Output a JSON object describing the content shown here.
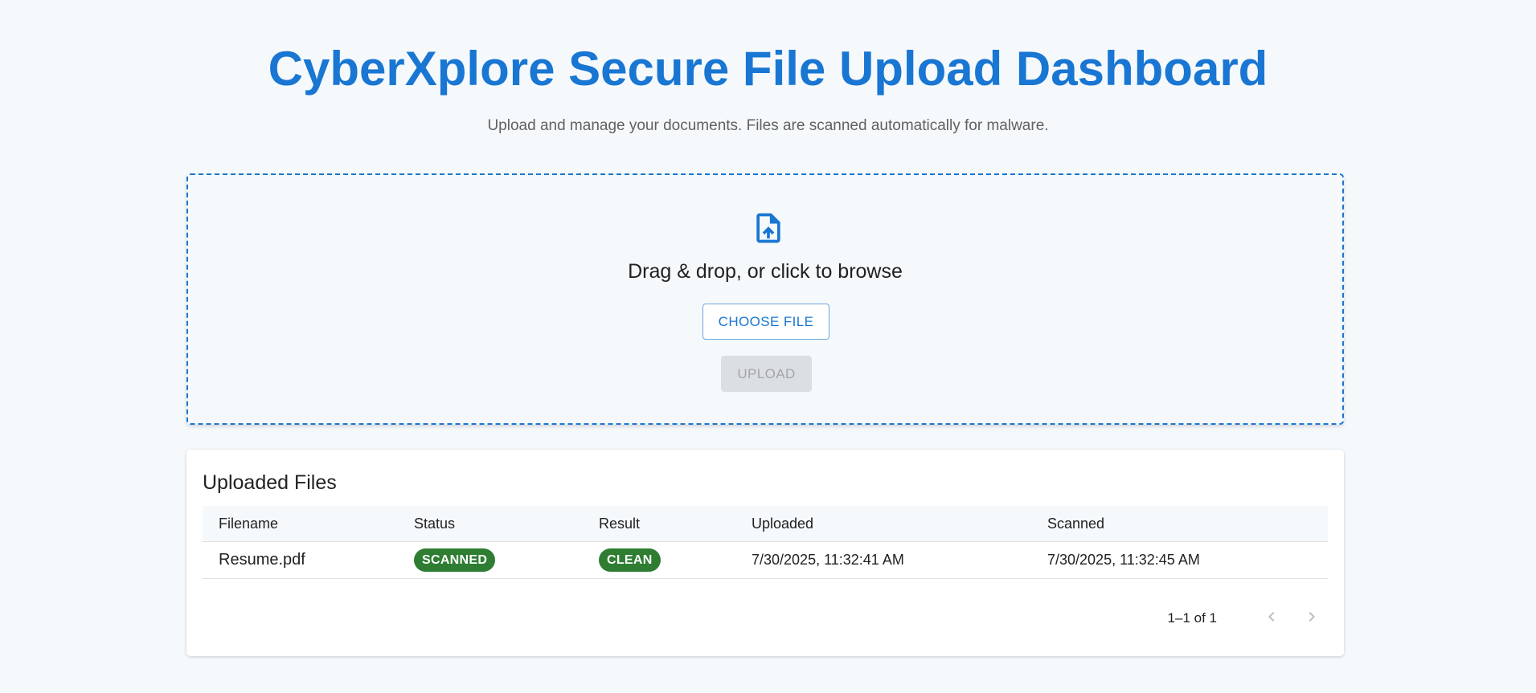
{
  "header": {
    "title": "CyberXplore Secure File Upload Dashboard",
    "subtitle": "Upload and manage your documents. Files are scanned automatically for malware."
  },
  "dropzone": {
    "icon": "file-upload-icon",
    "prompt": "Drag & drop, or click to browse",
    "choose_label": "CHOOSE FILE",
    "upload_label": "UPLOAD",
    "upload_disabled": true
  },
  "files": {
    "title": "Uploaded Files",
    "columns": [
      "Filename",
      "Status",
      "Result",
      "Uploaded",
      "Scanned"
    ],
    "rows": [
      {
        "filename": "Resume.pdf",
        "status": "SCANNED",
        "result": "CLEAN",
        "uploaded": "7/30/2025, 11:32:41 AM",
        "scanned": "7/30/2025, 11:32:45 AM"
      }
    ],
    "pagination": {
      "range": "1–1 of 1",
      "prev_icon": "chevron-left-icon",
      "next_icon": "chevron-right-icon"
    }
  },
  "colors": {
    "accent": "#1976d2",
    "chip_green": "#2e7d32",
    "background": "#f5f9fc"
  }
}
